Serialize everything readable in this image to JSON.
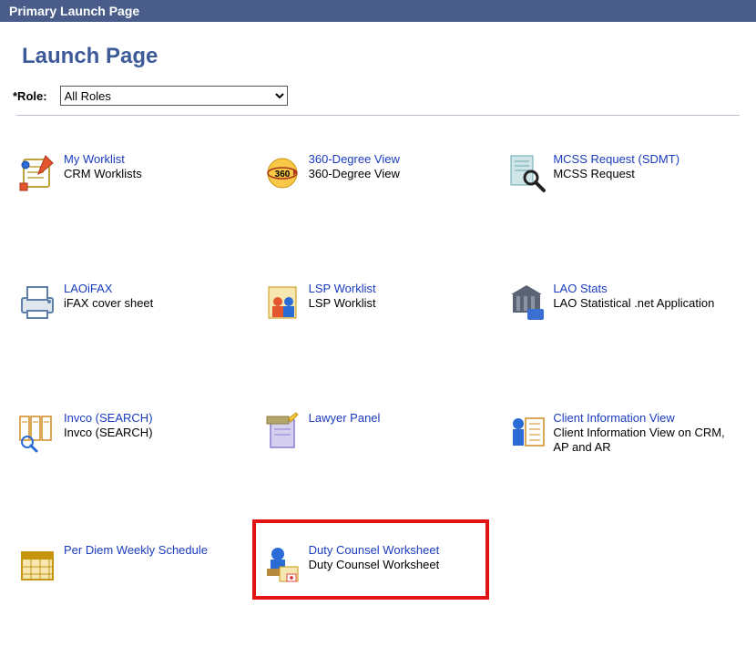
{
  "header": {
    "title": "Primary Launch Page"
  },
  "page": {
    "heading": "Launch Page"
  },
  "role": {
    "label": "*Role:",
    "selected": "All Roles"
  },
  "tiles": [
    {
      "key": "worklist",
      "link": "My Worklist",
      "desc": "CRM Worklists",
      "icon": "worklist-icon"
    },
    {
      "key": "view360",
      "link": "360-Degree View",
      "desc": "360-Degree View",
      "icon": "sphere-360-icon"
    },
    {
      "key": "mcss",
      "link": "MCSS Request (SDMT)",
      "desc": "MCSS Request",
      "icon": "document-search-icon"
    },
    {
      "key": "laoifax",
      "link": "LAOiFAX",
      "desc": "iFAX cover sheet",
      "icon": "fax-icon"
    },
    {
      "key": "lsp",
      "link": "LSP Worklist",
      "desc": "LSP Worklist",
      "icon": "people-icon"
    },
    {
      "key": "laostats",
      "link": "LAO Stats",
      "desc": "LAO Statistical .net Application",
      "icon": "stats-building-icon"
    },
    {
      "key": "invco",
      "link": "Invco (SEARCH)",
      "desc": "Invco (SEARCH)",
      "icon": "docs-search-icon"
    },
    {
      "key": "lawyer",
      "link": "Lawyer Panel",
      "desc": "",
      "icon": "notepad-icon"
    },
    {
      "key": "clientinfo",
      "link": "Client Information View",
      "desc": "Client Information View on CRM, AP and AR",
      "icon": "client-info-icon"
    },
    {
      "key": "perdiem",
      "link": "Per Diem Weekly Schedule",
      "desc": "",
      "icon": "calendar-icon"
    },
    {
      "key": "duty",
      "link": "Duty Counsel Worksheet",
      "desc": "Duty Counsel Worksheet",
      "icon": "person-files-icon",
      "highlight": true
    }
  ]
}
